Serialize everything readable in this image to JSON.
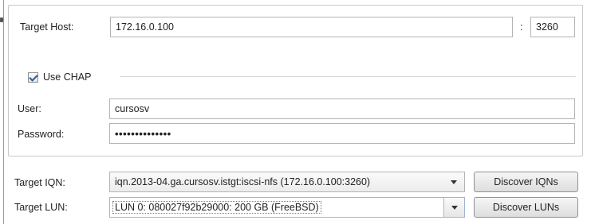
{
  "host": {
    "label": "Target Host:",
    "value": "172.16.0.100",
    "port_separator": ":",
    "port": "3260"
  },
  "chap": {
    "checkbox_label": "Use CHAP",
    "checked": true,
    "user_label": "User:",
    "user_value": "cursosv",
    "password_label": "Password:",
    "password_value": "••••••••••••••"
  },
  "target": {
    "iqn_label": "Target IQN:",
    "iqn_value": "iqn.2013-04.ga.cursosv.istgt:iscsi-nfs (172.16.0.100:3260)",
    "discover_iqns_label": "Discover IQNs",
    "lun_label": "Target LUN:",
    "lun_value": "LUN 0: 080027f92b29000: 200 GB (FreeBSD)",
    "discover_luns_label": "Discover LUNs"
  },
  "icons": {
    "checkbox": "checkmark-icon",
    "dropdown": "chevron-down-icon"
  }
}
